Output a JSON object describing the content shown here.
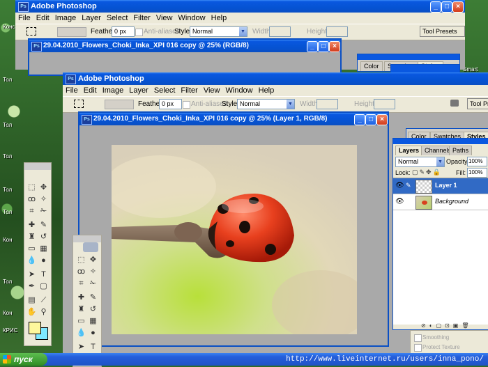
{
  "app": {
    "title": "Adobe Photoshop",
    "menus": [
      "File",
      "Edit",
      "Image",
      "Layer",
      "Select",
      "Filter",
      "View",
      "Window",
      "Help"
    ]
  },
  "options_bar": {
    "feather_label": "Feather:",
    "feather_value": "0 px",
    "antialiased_label": "Anti-aliased",
    "style_label": "Style:",
    "style_value": "Normal",
    "width_label": "Width:",
    "height_label": "Height:",
    "tool_presets_label": "Tool Presets"
  },
  "documents": {
    "back_title": "29.04.2010_Flowers_Choki_Inka_XPI 016 copy @ 25% (RGB/8)",
    "front_title": "29.04.2010_Flowers_Choki_Inka_XPI 016 copy @ 25% (Layer 1, RGB/8)"
  },
  "panels": {
    "top_tabs": [
      "Color",
      "Swatches",
      "Styles"
    ],
    "layers_tabs": [
      "Layers",
      "Channels",
      "Paths"
    ],
    "blend_mode": "Normal",
    "opacity_label": "Opacity:",
    "opacity_value": "100%",
    "lock_label": "Lock:",
    "fill_label": "Fill:",
    "fill_value": "100%",
    "layers": [
      {
        "name": "Layer 1",
        "selected": true
      },
      {
        "name": "Background",
        "selected": false
      }
    ],
    "behind_items": [
      "Smoothing",
      "Protect Texture"
    ]
  },
  "desktop": {
    "labels": [
      "Конс",
      "Тол",
      "Тол",
      "Тол",
      "Тол",
      "Тол",
      "Кон",
      "Тол",
      "Кон",
      "Тол",
      "Тол",
      "КРИС",
      "Тол",
      "КРИС",
      "Тол",
      "Smart"
    ]
  },
  "taskbar": {
    "start_label": "пуск",
    "watermark": "http://www.liveinternet.ru/users/inna_pono/"
  },
  "colors": {
    "title_blue": "#0553d3",
    "selected_layer": "#316ac5",
    "foreground_swatch": "#fdf79c",
    "background_swatch": "#7ee8ff"
  }
}
